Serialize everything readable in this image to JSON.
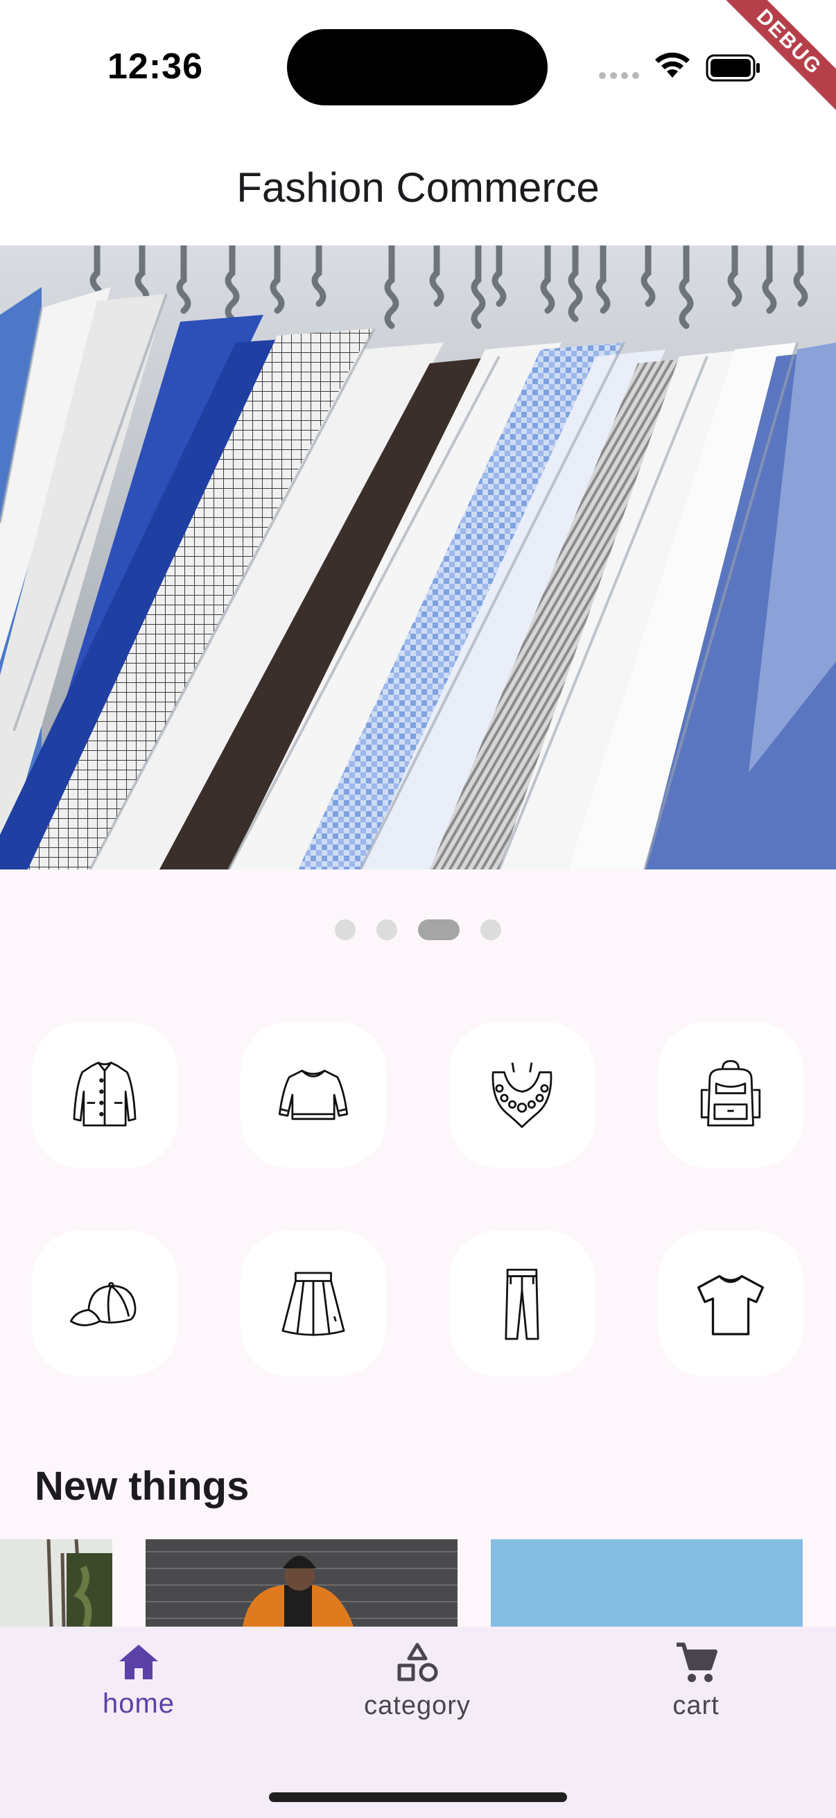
{
  "status_bar": {
    "time": "12:36",
    "debug_banner": "DEBUG"
  },
  "app_bar": {
    "title": "Fashion Commerce"
  },
  "carousel": {
    "slide_count": 4,
    "active_index": 2
  },
  "categories": [
    {
      "icon": "jacket-icon"
    },
    {
      "icon": "sweater-icon"
    },
    {
      "icon": "necklace-icon"
    },
    {
      "icon": "backpack-icon"
    },
    {
      "icon": "cap-icon"
    },
    {
      "icon": "skirt-icon"
    },
    {
      "icon": "pants-icon"
    },
    {
      "icon": "tshirt-icon"
    }
  ],
  "new_things": {
    "title": "New things"
  },
  "bottom_nav": {
    "items": [
      {
        "label": "home",
        "icon": "home-icon",
        "active": true
      },
      {
        "label": "category",
        "icon": "category-icon",
        "active": false
      },
      {
        "label": "cart",
        "icon": "cart-icon",
        "active": false
      }
    ]
  },
  "colors": {
    "accent": "#5b41a6",
    "background": "#fdf7fc",
    "nav_background": "#f4ecf6"
  }
}
